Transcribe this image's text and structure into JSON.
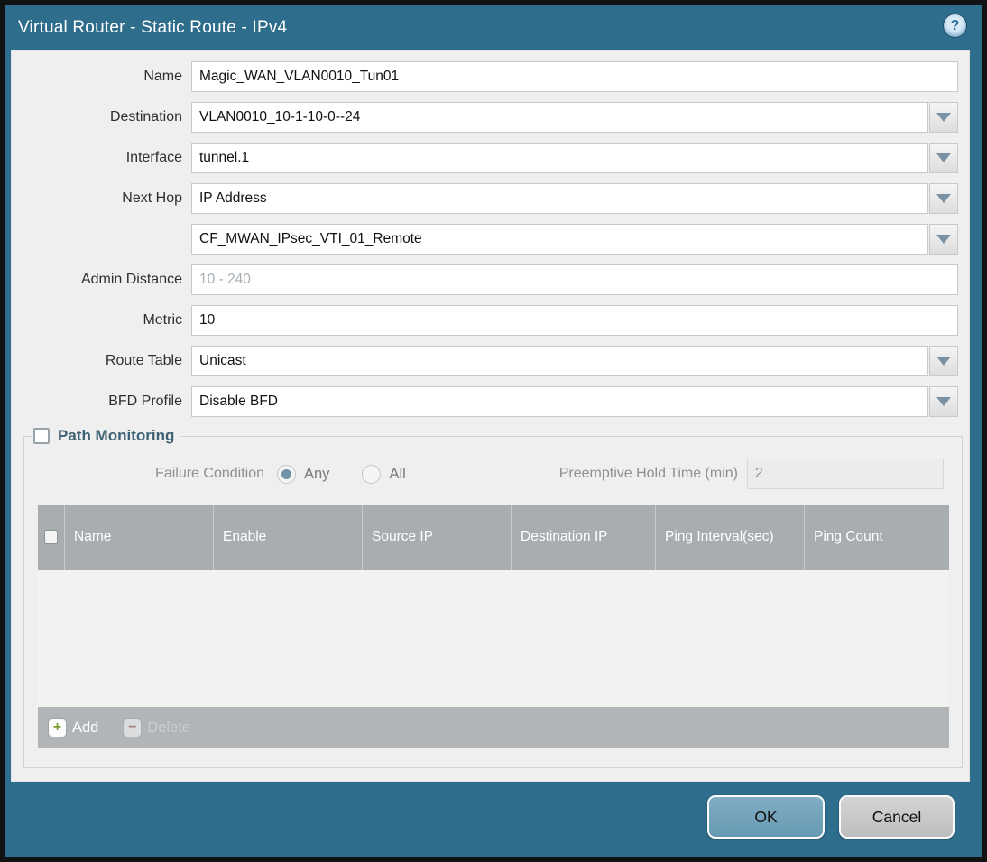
{
  "window": {
    "title": "Virtual Router - Static Route - IPv4",
    "help_glyph": "?"
  },
  "form": {
    "fields": [
      {
        "label": "Name",
        "value": "Magic_WAN_VLAN0010_Tun01",
        "type": "text"
      },
      {
        "label": "Destination",
        "value": "VLAN0010_10-1-10-0--24",
        "type": "dropdown"
      },
      {
        "label": "Interface",
        "value": "tunnel.1",
        "type": "dropdown"
      },
      {
        "label": "Next Hop",
        "value": "IP Address",
        "type": "dropdown"
      },
      {
        "label": "",
        "value": "CF_MWAN_IPsec_VTI_01_Remote",
        "type": "dropdown"
      },
      {
        "label": "Admin Distance",
        "value": "",
        "placeholder": "10 - 240",
        "type": "text"
      },
      {
        "label": "Metric",
        "value": "10",
        "type": "text"
      },
      {
        "label": "Route Table",
        "value": "Unicast",
        "type": "dropdown"
      },
      {
        "label": "BFD Profile",
        "value": "Disable BFD",
        "type": "dropdown"
      }
    ]
  },
  "path_monitoring": {
    "title": "Path Monitoring",
    "checkbox_checked": false,
    "failure_condition_label": "Failure Condition",
    "options": [
      {
        "label": "Any",
        "selected": true
      },
      {
        "label": "All",
        "selected": false
      }
    ],
    "hold_time_label": "Preemptive Hold Time (min)",
    "hold_time_value": "2",
    "table": {
      "columns": [
        "Name",
        "Enable",
        "Source IP",
        "Destination IP",
        "Ping Interval(sec)",
        "Ping Count"
      ],
      "rows": []
    },
    "add_label": "Add",
    "add_glyph": "+",
    "delete_label": "Delete",
    "delete_glyph": "−"
  },
  "footer": {
    "ok_label": "OK",
    "cancel_label": "Cancel"
  },
  "colors": {
    "titlebar_teal": "#2e6d8c",
    "panel_gray": "#efefef",
    "table_header_gray": "#a8adb0",
    "footer_bar_gray": "#b1b5b8",
    "ok_button_blue": "#74a6bc",
    "cancel_button_gray": "#c8c8ca",
    "add_icon_green": "#7d9c35",
    "delete_icon_red": "#9c5f55",
    "dropdown_arrow_blue_gray": "#7a91a3"
  }
}
